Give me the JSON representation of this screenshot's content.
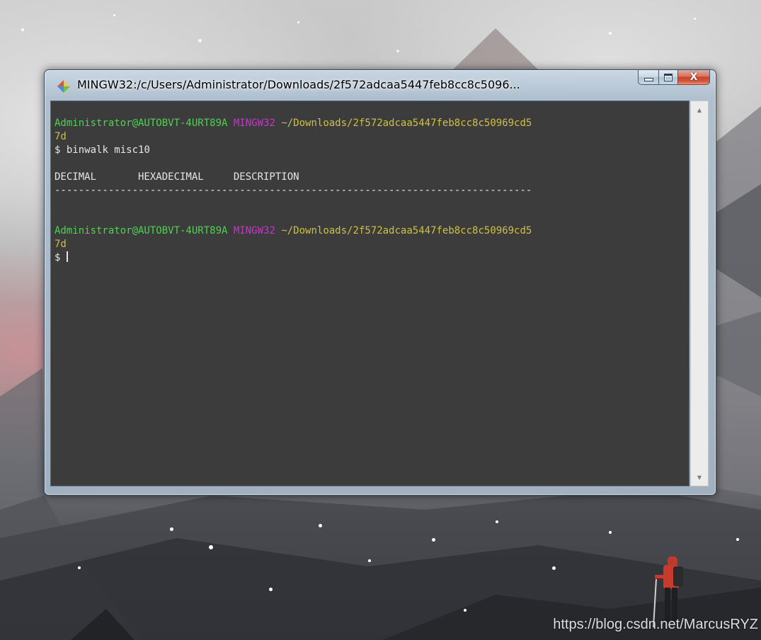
{
  "window": {
    "title": "MINGW32:/c/Users/Administrator/Downloads/2f572adcaa5447feb8cc8c5096...",
    "icon": "git-bash-icon",
    "buttons": {
      "minimize": "minimize",
      "maximize": "maximize",
      "close": "X"
    }
  },
  "terminal": {
    "prompt1": {
      "user": "Administrator@AUTOBVT-4URT89A",
      "system": "MINGW32",
      "path_line1": "~/Downloads/2f572adcaa5447feb8cc8c50969cd5",
      "path_line2": "7d",
      "symbol": "$",
      "command": "binwalk misc10"
    },
    "table_header": "DECIMAL       HEXADECIMAL     DESCRIPTION",
    "separator": "--------------------------------------------------------------------------------",
    "prompt2": {
      "user": "Administrator@AUTOBVT-4URT89A",
      "system": "MINGW32",
      "path_line1": "~/Downloads/2f572adcaa5447feb8cc8c50969cd5",
      "path_line2": "7d",
      "symbol": "$"
    }
  },
  "colors": {
    "prompt_user": "#4fd251",
    "prompt_system": "#c636c9",
    "prompt_path": "#cfc140",
    "terminal_bg": "#3c3c3c",
    "terminal_text": "#e6e6e6"
  },
  "watermark": "https://blog.csdn.net/MarcusRYZ"
}
